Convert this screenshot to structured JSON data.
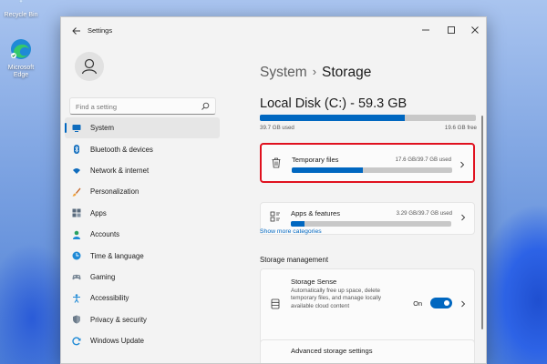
{
  "desktop": {
    "icons": [
      {
        "label": "Recycle Bin"
      },
      {
        "label": "Microsoft Edge"
      }
    ]
  },
  "window": {
    "title": "Settings",
    "back_icon": "back-arrow-icon",
    "controls": [
      "minimize-icon",
      "maximize-icon",
      "close-icon"
    ]
  },
  "sidebar": {
    "search_placeholder": "Find a setting",
    "items": [
      {
        "label": "System",
        "icon": "monitor-icon",
        "active": true
      },
      {
        "label": "Bluetooth & devices",
        "icon": "bluetooth-icon"
      },
      {
        "label": "Network & internet",
        "icon": "wifi-icon"
      },
      {
        "label": "Personalization",
        "icon": "brush-icon"
      },
      {
        "label": "Apps",
        "icon": "apps-icon"
      },
      {
        "label": "Accounts",
        "icon": "person-icon"
      },
      {
        "label": "Time & language",
        "icon": "clock-globe-icon"
      },
      {
        "label": "Gaming",
        "icon": "gamepad-icon"
      },
      {
        "label": "Accessibility",
        "icon": "accessibility-icon"
      },
      {
        "label": "Privacy & security",
        "icon": "shield-icon"
      },
      {
        "label": "Windows Update",
        "icon": "update-icon"
      }
    ]
  },
  "main": {
    "breadcrumb": {
      "parent": "System",
      "separator": "›",
      "current": "Storage"
    },
    "disk": {
      "title": "Local Disk (C:) - 59.3 GB",
      "used_label": "39.7 GB used",
      "free_label": "19.6 GB free",
      "used_fraction": 0.67
    },
    "categories": [
      {
        "title": "Temporary files",
        "size": "17.6 GB/39.7 GB used",
        "fraction": 0.443,
        "icon": "trash-icon",
        "highlighted": true
      },
      {
        "title": "Apps & features",
        "size": "3.29 GB/39.7 GB used",
        "fraction": 0.083,
        "icon": "apps-list-icon",
        "highlighted": false
      }
    ],
    "show_more": "Show more categories",
    "storage_management": {
      "heading": "Storage management",
      "sense": {
        "title": "Storage Sense",
        "description": "Automatically free up space, delete temporary files, and manage locally available cloud content",
        "toggle_label": "On",
        "toggle_on": true
      },
      "advanced": {
        "title": "Advanced storage settings"
      }
    }
  },
  "colors": {
    "accent": "#0067c0",
    "highlight": "#e0111f"
  }
}
